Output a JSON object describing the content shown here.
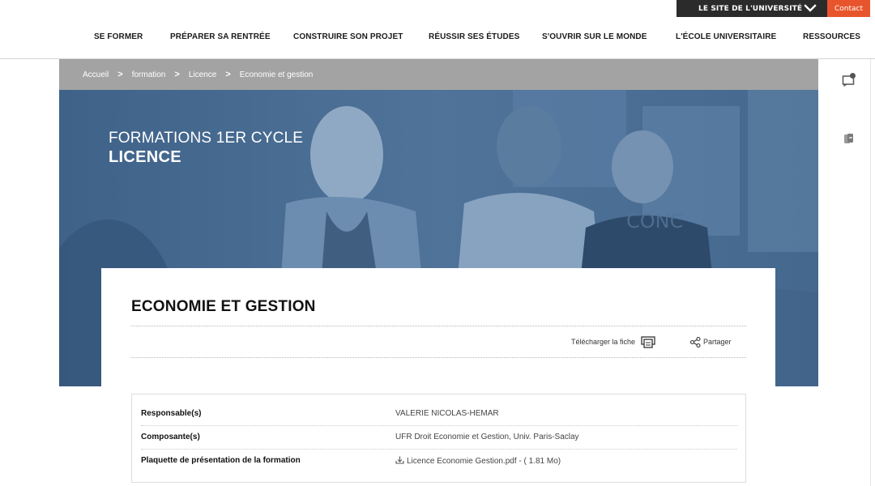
{
  "topbar": {
    "university_site_label": "LE SITE DE L'UNIVERSITÉ",
    "contact_label": "Contact"
  },
  "nav": {
    "items": [
      "SE FORMER",
      "PRÉPARER SA RENTRÉE",
      "CONSTRUIRE SON PROJET",
      "RÉUSSIR SES ÉTUDES",
      "S'OUVRIR SUR LE MONDE",
      "L'ÉCOLE UNIVERSITAIRE",
      "RESSOURCES"
    ]
  },
  "breadcrumb": {
    "items": [
      "Accueil",
      "formation",
      "Licence",
      "Economie et gestion"
    ],
    "separator": ">"
  },
  "hero": {
    "kicker": "FORMATIONS 1ER CYCLE",
    "title": "LICENCE"
  },
  "card": {
    "title": "ECONOMIE ET GESTION",
    "download_label": "Télécharger la fiche",
    "share_label": "Partager"
  },
  "info": {
    "rows": [
      {
        "label": "Responsable(s)",
        "value": "VALERIE NICOLAS-HEMAR"
      },
      {
        "label": "Composante(s)",
        "value": "UFR Droit Economie et Gestion, Univ. Paris-Saclay"
      },
      {
        "label": "Plaquette de présentation de la formation",
        "value": "Licence Economie Gestion.pdf - ( 1.81 Mo)"
      }
    ]
  },
  "colors": {
    "hero_blue": "#4a6d92",
    "breadcrumb_gray": "#a3a3a3",
    "topbar_dark": "#2b2b2b",
    "contact_orange": "#e8552d"
  },
  "icons": {
    "university_toggle": "chevron-down-icon",
    "download": "print-icon",
    "share": "share-icon",
    "file": "download-tray-icon",
    "sidebar_1": "chat-bubble-icon",
    "sidebar_2": "books-icon"
  }
}
